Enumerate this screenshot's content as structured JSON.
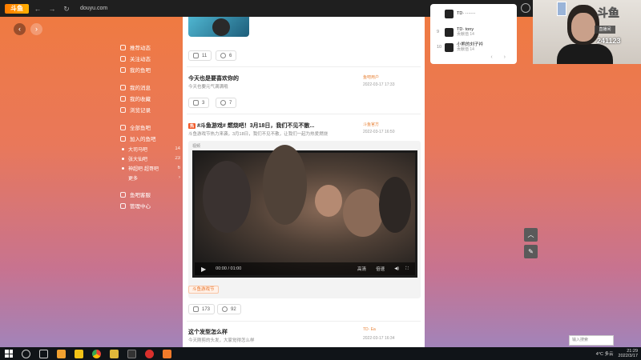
{
  "browser": {
    "url": "douyu.com"
  },
  "nav": {
    "items": [
      {
        "label": "推荐动态"
      },
      {
        "label": "关注动态"
      },
      {
        "label": "我的鱼吧"
      }
    ],
    "items2": [
      {
        "label": "我的消息"
      },
      {
        "label": "我的收藏"
      },
      {
        "label": "浏览记录"
      }
    ],
    "items3": [
      {
        "label": "全部鱼吧"
      },
      {
        "label": "加入的鱼吧"
      }
    ],
    "groups": [
      {
        "label": "大司马吧",
        "count": "14"
      },
      {
        "label": "张大仙吧",
        "count": "23"
      },
      {
        "label": "神超吧·超哥吧",
        "count": "6"
      },
      {
        "label": "更多",
        "count": "›"
      }
    ],
    "items4": [
      {
        "label": "鱼吧客服"
      },
      {
        "label": "管理中心"
      }
    ]
  },
  "feed": {
    "post0": {
      "likes": "11",
      "comments": "6"
    },
    "post1": {
      "title": "今天也是要喜欢你的",
      "sub": "今天也要元气满满哦",
      "author": "鱼吧用户",
      "time": "2022-03-17 17:33",
      "likes": "3",
      "comments": "7"
    },
    "post2": {
      "tag": "热",
      "title": "#斗鱼游戏# 燃烧吧！3月18日，我们不见不散...",
      "sub": "斗鱼游戏节热力来袭，3月18日，我们不见不散，让我们一起为热爱燃烧",
      "author": "斗鱼官方",
      "time": "2022-03-17 16:50",
      "label": "视频",
      "video_time": "00:00 / 01:00",
      "video_opt1": "高清",
      "video_opt2": "倍速",
      "video_tag": "斗鱼游戏节",
      "likes": "173",
      "comments": "92"
    },
    "post3": {
      "title": "这个发型怎么样",
      "sub": "今天刚剪的头发，大家觉得怎么样",
      "author": "TD· Ea",
      "time": "2022-03-17 16:34"
    }
  },
  "right_panel": {
    "rows": [
      {
        "rank": "",
        "name": "TD· ·······",
        "sub": ""
      },
      {
        "rank": "9",
        "name": "TD· tony",
        "sub": "贡献值 14"
      },
      {
        "rank": "10",
        "name": "小熊的刘子衿",
        "sub": "贡献值 14"
      }
    ],
    "pager": "‹ ›"
  },
  "cam": {
    "logo": "斗鱼",
    "box": "直播间",
    "num": "241123"
  },
  "float": {
    "up": "︿",
    "edit": "✎"
  },
  "search": {
    "placeholder": "输入搜索"
  },
  "taskbar": {
    "weather": "4°C 多云",
    "time": "21:29",
    "date": "2022/3/17"
  }
}
